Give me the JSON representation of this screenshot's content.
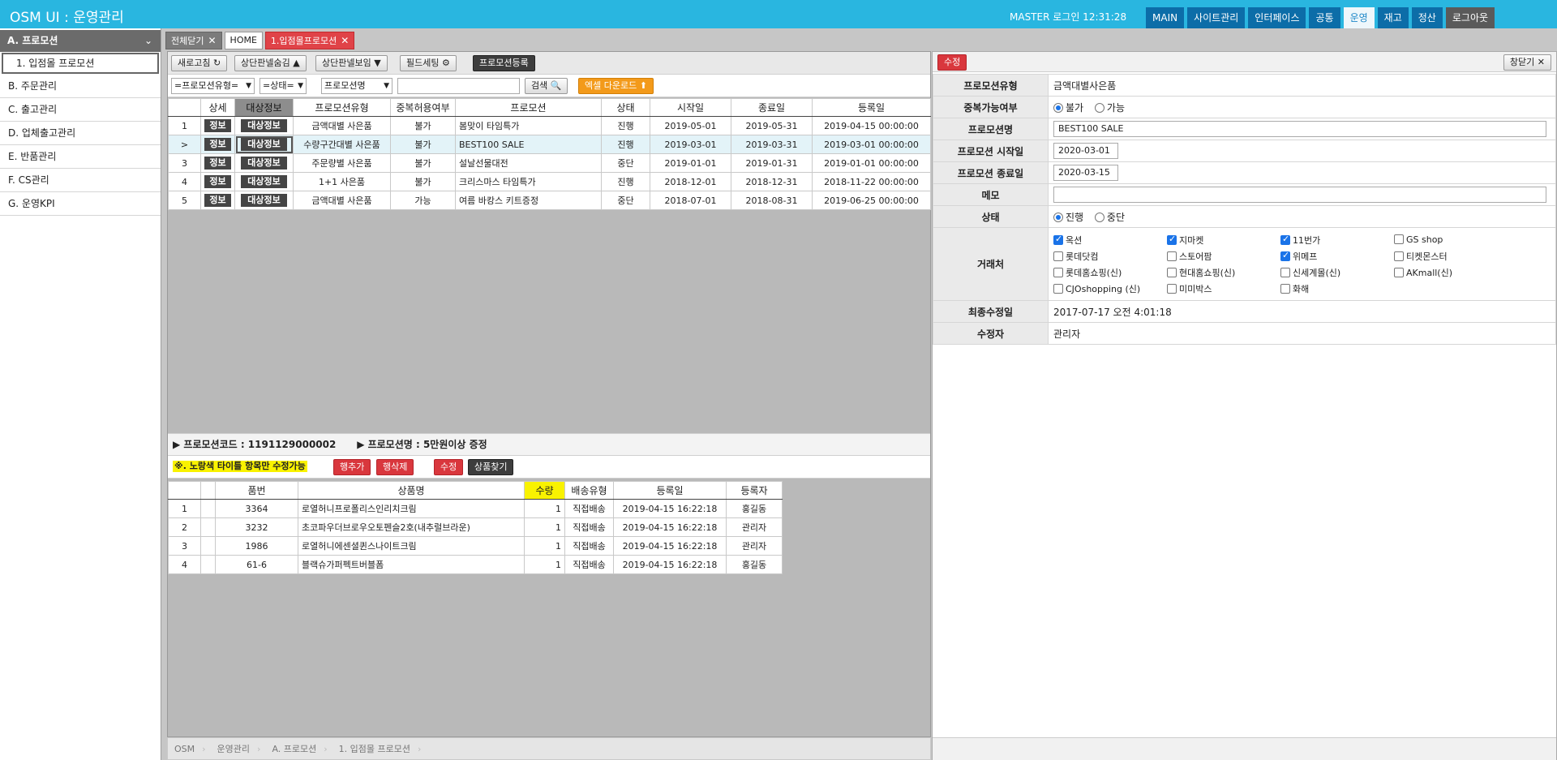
{
  "header": {
    "app_title": "OSM UI : 운영관리",
    "login_info": "MASTER 로그인 12:31:28",
    "nav": [
      "MAIN",
      "사이트관리",
      "인터페이스",
      "공통",
      "운영",
      "재고",
      "정산",
      "로그아웃"
    ],
    "active_nav": "운영"
  },
  "sidebar": {
    "section": "A. 프로모션",
    "chevron": "⌄",
    "sub_item": "1. 입점몰 프로모션",
    "items": [
      "B. 주문관리",
      "C. 출고관리",
      "D. 업체출고관리",
      "E. 반품관리",
      "F. CS관리",
      "G. 운영KPI"
    ]
  },
  "tabs": [
    {
      "label": "전체닫기",
      "close": "✕"
    },
    {
      "label": "HOME"
    },
    {
      "label": "1.입점몰프로모션",
      "close": "✕"
    }
  ],
  "toolbar": {
    "refresh": "새로고침 ↻",
    "hide_top": "상단판넬숨김 ▲",
    "show_top": "상단판넬보임 ▼",
    "field_setting": "필드세팅 ⚙",
    "register": "프로모션등록"
  },
  "filters": {
    "type_select": "=프로모션유형=",
    "status_select": "=상태=",
    "name_select": "프로모션명",
    "search_value": "",
    "search_button": "검색 🔍",
    "excel_button": "엑셀 다운로드 ⬆"
  },
  "main_table": {
    "headers": [
      "",
      "상세",
      "대상정보",
      "프로모션유형",
      "중복허용여부",
      "프로모션",
      "상태",
      "시작일",
      "종료일",
      "등록일"
    ],
    "detail_chip": "정보",
    "target_chip": "대상정보",
    "rows": [
      {
        "no": "1",
        "type": "금액대별 사은품",
        "dup": "불가",
        "name": "봄맞이 타임특가",
        "status": "진행",
        "start": "2019-05-01",
        "end": "2019-05-31",
        "reg": "2019-04-15 00:00:00"
      },
      {
        "no": ">",
        "type": "수량구간대별 사은품",
        "dup": "불가",
        "name": "BEST100 SALE",
        "status": "진행",
        "start": "2019-03-01",
        "end": "2019-03-31",
        "reg": "2019-03-01 00:00:00"
      },
      {
        "no": "3",
        "type": "주문량별 사은품",
        "dup": "불가",
        "name": "설날선물대전",
        "status": "중단",
        "start": "2019-01-01",
        "end": "2019-01-31",
        "reg": "2019-01-01 00:00:00"
      },
      {
        "no": "4",
        "type": "1+1 사은품",
        "dup": "불가",
        "name": "크리스마스 타임특가",
        "status": "진행",
        "start": "2018-12-01",
        "end": "2018-12-31",
        "reg": "2018-11-22 00:00:00"
      },
      {
        "no": "5",
        "type": "금액대별 사은품",
        "dup": "가능",
        "name": "여름 바캉스 키트증정",
        "status": "중단",
        "start": "2018-07-01",
        "end": "2018-08-31",
        "reg": "2019-06-25 00:00:00"
      }
    ]
  },
  "info_bar": {
    "code": "▶ 프로모션코드 : 1191129000002",
    "name": "▶ 프로모션명 : 5만원이상 증정"
  },
  "action_bar": {
    "warning": "※. 노랑색 타이틀 항목만 수정가능",
    "add_row": "행추가",
    "delete_row": "행삭제",
    "edit": "수정",
    "find_product": "상품찾기"
  },
  "detail_table": {
    "headers": [
      "",
      "",
      "품번",
      "상품명",
      "수량",
      "배송유형",
      "등록일",
      "등록자"
    ],
    "rows": [
      {
        "no": "1",
        "code": "3364",
        "name": "로열허니프로폴리스인리치크림",
        "qty": "1",
        "ship": "직접배송",
        "reg": "2019-04-15 16:22:18",
        "user": "홍길동"
      },
      {
        "no": "2",
        "code": "3232",
        "name": "초코파우더브로우오토펜슬2호(내추럴브라운)",
        "qty": "1",
        "ship": "직접배송",
        "reg": "2019-04-15 16:22:18",
        "user": "관리자"
      },
      {
        "no": "3",
        "code": "1986",
        "name": "로열허니에센셜퀸스나이트크림",
        "qty": "1",
        "ship": "직접배송",
        "reg": "2019-04-15 16:22:18",
        "user": "관리자"
      },
      {
        "no": "4",
        "code": "61-6",
        "name": "블랙슈가퍼펙트버블폼",
        "qty": "1",
        "ship": "직접배송",
        "reg": "2019-04-15 16:22:18",
        "user": "홍길동"
      }
    ]
  },
  "breadcrumb": [
    "OSM",
    "운영관리",
    "A. 프로모션",
    "1. 입점몰 프로모션"
  ],
  "right_panel": {
    "edit_button": "수정",
    "close_button": "창닫기 ✕",
    "fields": {
      "type_label": "프로모션유형",
      "type_value": "금액대별사은품",
      "dup_label": "중복가능여부",
      "dup_options": [
        "불가",
        "가능"
      ],
      "dup_selected": "불가",
      "name_label": "프로모션명",
      "name_value": "BEST100 SALE",
      "start_label": "프로모션 시작일",
      "start_value": "2020-03-01",
      "end_label": "프로모션 종료일",
      "end_value": "2020-03-15",
      "memo_label": "메모",
      "memo_value": "",
      "status_label": "상태",
      "status_options": [
        "진행",
        "중단"
      ],
      "status_selected": "진행",
      "partner_label": "거래처",
      "modified_label": "최종수정일",
      "modified_value": "2017-07-17 오전 4:01:18",
      "modifier_label": "수정자",
      "modifier_value": "관리자"
    },
    "partners": [
      {
        "name": "옥션",
        "checked": true
      },
      {
        "name": "지마켓",
        "checked": true
      },
      {
        "name": "11번가",
        "checked": true
      },
      {
        "name": "GS shop",
        "checked": false
      },
      {
        "name": "롯데닷컴",
        "checked": false
      },
      {
        "name": "스토어팜",
        "checked": false
      },
      {
        "name": "위메프",
        "checked": true
      },
      {
        "name": "티켓몬스터",
        "checked": false
      },
      {
        "name": "롯데홈쇼핑(신)",
        "checked": false
      },
      {
        "name": "현대홈쇼핑(신)",
        "checked": false
      },
      {
        "name": "신세계몰(신)",
        "checked": false
      },
      {
        "name": "AKmall(신)",
        "checked": false
      },
      {
        "name": "CJOshopping (신)",
        "checked": false
      },
      {
        "name": "미미박스",
        "checked": false
      },
      {
        "name": "화해",
        "checked": false
      }
    ]
  },
  "colors": {
    "header_bg": "#29b6e0",
    "nav_bg": "#0c6da8",
    "accent_red": "#e04348",
    "warning_yellow": "#f9f200",
    "excel_orange": "#f39a1a"
  }
}
